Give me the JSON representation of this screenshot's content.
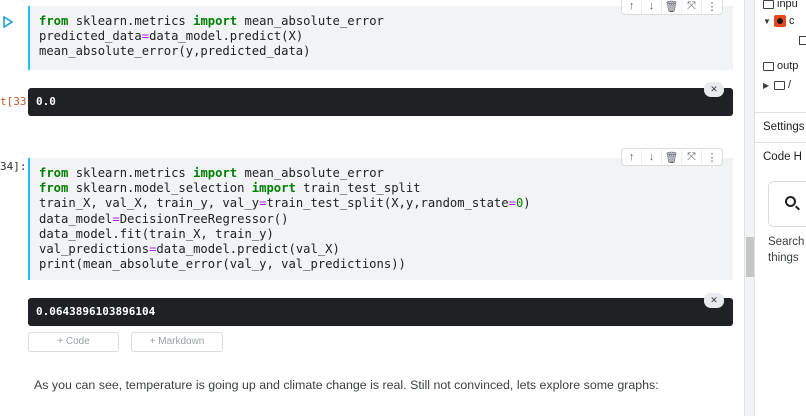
{
  "cells": [
    {
      "lines": [
        [
          [
            "kw",
            "from"
          ],
          [
            "t",
            " sklearn.metrics "
          ],
          [
            "kw",
            "import"
          ],
          [
            "t",
            " mean_absolute_error"
          ]
        ],
        [
          [
            "t",
            "predicted_data"
          ],
          [
            "eq",
            "="
          ],
          [
            "t",
            "data_model.predict(X)"
          ]
        ],
        [
          [
            "t",
            "mean_absolute_error(y,predicted_data)"
          ]
        ]
      ]
    },
    {
      "prompt": "34]:",
      "lines": [
        [
          [
            "kw",
            "from"
          ],
          [
            "t",
            " sklearn.metrics "
          ],
          [
            "kw",
            "import"
          ],
          [
            "t",
            " mean_absolute_error"
          ]
        ],
        [
          [
            "kw",
            "from"
          ],
          [
            "t",
            " sklearn.model_selection "
          ],
          [
            "kw",
            "import"
          ],
          [
            "t",
            " train_test_split"
          ]
        ],
        [
          [
            "t",
            "train_X, val_X, train_y, val_y"
          ],
          [
            "eq",
            "="
          ],
          [
            "t",
            "train_test_split(X,y,random_state"
          ],
          [
            "eq",
            "="
          ],
          [
            "num",
            "0"
          ],
          [
            "t",
            ")"
          ]
        ],
        [
          [
            "t",
            "data_model"
          ],
          [
            "eq",
            "="
          ],
          [
            "t",
            "DecisionTreeRegressor()"
          ]
        ],
        [
          [
            "t",
            "data_model.fit(train_X, train_y)"
          ]
        ],
        [
          [
            "t",
            "val_predictions"
          ],
          [
            "eq",
            "="
          ],
          [
            "t",
            "data_model.predict(val_X)"
          ]
        ],
        [
          [
            "t",
            "print(mean_absolute_error(val_y, val_predictions))"
          ]
        ]
      ]
    }
  ],
  "outputs": [
    {
      "prompt": "t[33]",
      "text": "0.0"
    },
    {
      "text": "0.0643896103896104"
    }
  ],
  "toolbar_icons": [
    "arrow-up-icon",
    "arrow-down-icon",
    "delete-icon",
    "collapse-icon",
    "more-icon"
  ],
  "toolbar_glyphs": [
    "↑",
    "↓",
    "🗑",
    "⤧",
    "⋮"
  ],
  "add_buttons": {
    "code": "+ Code",
    "markdown": "+ Markdown"
  },
  "markdown_text": "As you can see, temperature is going up and climate change is real. Still not convinced, lets explore some graphs:",
  "panel": {
    "input_label": "inpu",
    "dataset_label": "c",
    "output_label": "outp",
    "output_child": "/",
    "settings_label": "Settings",
    "code_help_label": "Code H",
    "search_text_1": "Search",
    "search_text_2": "things"
  }
}
